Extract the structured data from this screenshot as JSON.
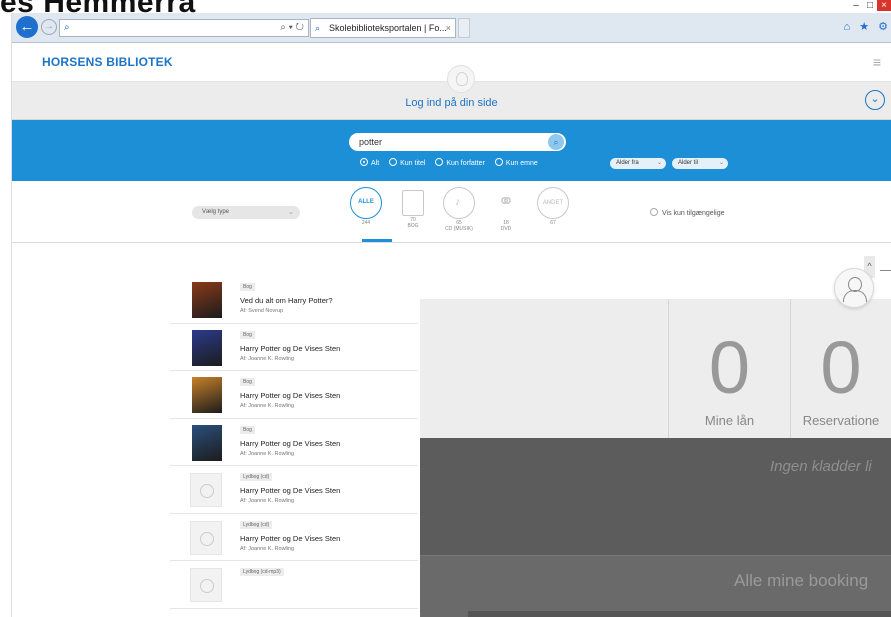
{
  "overlay": {
    "heading": "es Hemmerra"
  },
  "browser": {
    "back": "←",
    "forward": "→",
    "address_ctrls": "⌕ ▾ ↻",
    "tab_title": "Skolebiblioteksportalen | Fo...",
    "tab_close": "×",
    "window_min": "–",
    "window_max": "□",
    "window_close": "×",
    "toolbar_icons": "⌂ ★ ⚙"
  },
  "site": {
    "logo": "HORSENS BIBLIOTEK",
    "menu_icon": "≡",
    "login_text": "Log ind på din side",
    "login_chevron": "⌄"
  },
  "search": {
    "query": "potter",
    "button_icon": "⌕",
    "options": [
      {
        "label": "Alt",
        "selected": true
      },
      {
        "label": "Kun titel",
        "selected": false
      },
      {
        "label": "Kun forfatter",
        "selected": false
      },
      {
        "label": "Kun emne",
        "selected": false
      }
    ],
    "age_from": "Alder fra",
    "age_to": "Alder til"
  },
  "filters": {
    "type_select": "Vælg type",
    "media_types": [
      {
        "label": "ALLE",
        "count": "244"
      },
      {
        "label": "",
        "count": "70\nBOG"
      },
      {
        "label": "",
        "count": "65\nCD (MUSIK)"
      },
      {
        "label": "",
        "count": "18\nDVD"
      },
      {
        "label": "ANDET",
        "count": "67"
      }
    ],
    "available_only": "Vis kun tilgængelige"
  },
  "results": [
    {
      "type": "Bog",
      "title": "Ved du alt om Harry Potter?",
      "author": "Af: Svend Novrup",
      "cover": "#8a3a1a"
    },
    {
      "type": "Bog",
      "title": "Harry Potter og De Vises Sten",
      "author": "Af: Joanne K. Rowling",
      "cover": "#2b3b8c"
    },
    {
      "type": "Bog",
      "title": "Harry Potter og De Vises Sten",
      "author": "Af: Joanne K. Rowling",
      "cover": "#c8812a"
    },
    {
      "type": "Bog",
      "title": "Harry Potter og De Vises Sten",
      "author": "Af: Joanne K. Rowling",
      "cover": "#2a4f7d"
    },
    {
      "type": "Lydbog (cd)",
      "title": "Harry Potter og De Vises Sten",
      "author": "Af: Joanne K. Rowling",
      "cover": ""
    },
    {
      "type": "Lydbog (cd)",
      "title": "Harry Potter og De Vises Sten",
      "author": "Af: Joanne K. Rowling",
      "cover": ""
    },
    {
      "type": "Lydbog (cd-mp3)",
      "title": "",
      "author": "",
      "cover": ""
    }
  ],
  "dashboard": {
    "loans_count": "0",
    "loans_label": "Mine lån",
    "reservations_count": "0",
    "reservations_label": "Reservatione",
    "drafts_text": "Ingen kladder li",
    "bookings_text": "Alle mine booking",
    "scroll_icon": "^"
  },
  "colors": {
    "brand_blue": "#1d8fd6",
    "logo_blue": "#1d74c6",
    "dash_dark": "#5c5c5c"
  }
}
